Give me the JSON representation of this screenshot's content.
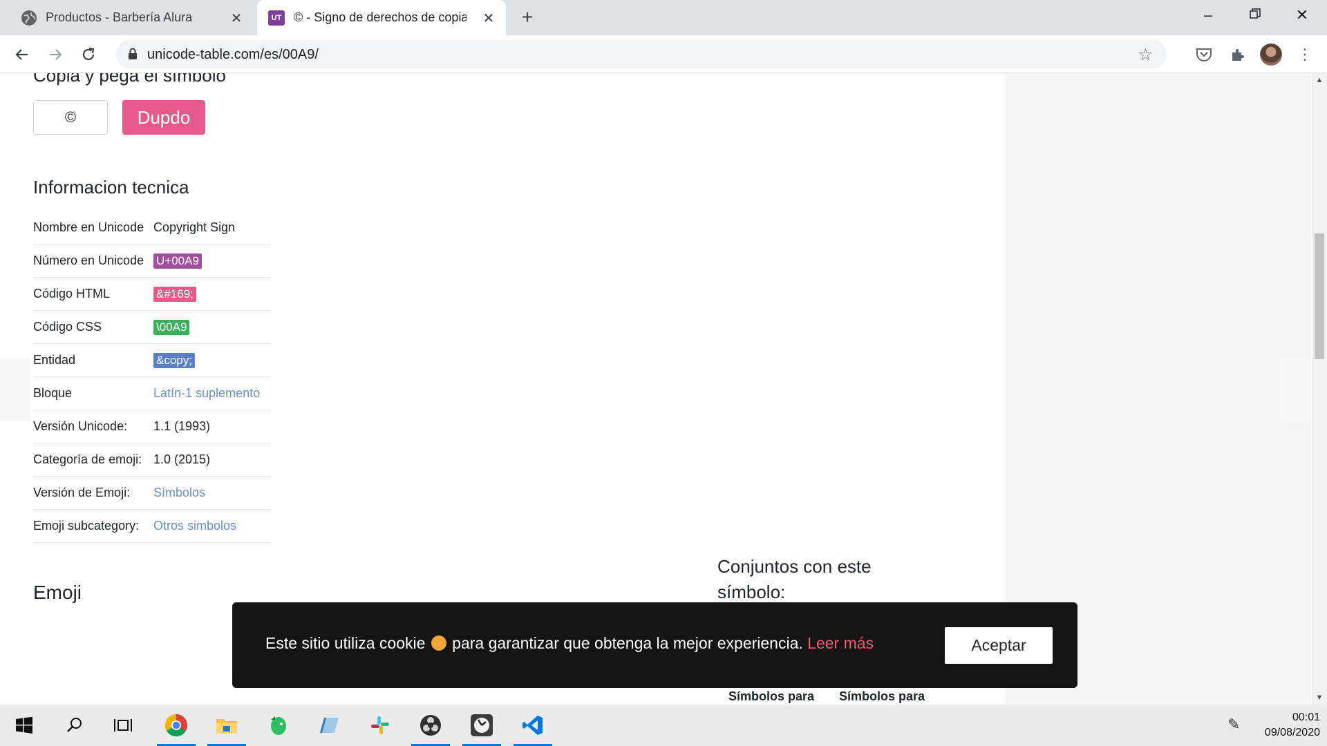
{
  "browser": {
    "tabs": [
      {
        "title": "Productos - Barbería Alura",
        "favicon": "globe-icon"
      },
      {
        "title": "© - Signo de derechos de copia",
        "favicon": "ut-icon"
      }
    ],
    "url": "unicode-table.com/es/00A9/",
    "favicon_ut_text": "UT"
  },
  "page": {
    "copy_heading": "Copia y pega el símbolo",
    "symbol": "©",
    "copy_button": "Dupdo",
    "info_heading": "Informacion tecnica",
    "info_rows": [
      {
        "key": "Nombre en Unicode",
        "value": "Copyright Sign"
      },
      {
        "key": "Número en Unicode",
        "value": "U+00A9"
      },
      {
        "key": "Código HTML",
        "value": "&#169;"
      },
      {
        "key": "Código CSS",
        "value": "\\00A9"
      },
      {
        "key": "Entidad",
        "value": "&copy;"
      },
      {
        "key": "Bloque",
        "value": "Latín-1 suplemento"
      },
      {
        "key": "Versión Unicode:",
        "value": "1.1 (1993)"
      },
      {
        "key": "Categoría de emoji:",
        "value": "1.0 (2015)"
      },
      {
        "key": "Versión de Emoji:",
        "value": "Símbolos"
      },
      {
        "key": "Emoji subcategory:",
        "value": "Otros simbolos"
      }
    ],
    "emoji_heading": "Emoji",
    "sets_heading": "Conjuntos con este símbolo:",
    "sets_links": [
      "Símbolos para",
      "Símbolos para"
    ]
  },
  "cookie_banner": {
    "text_before": "Este sitio utiliza cookie",
    "text_after": "para garantizar que obtenga la mejor experiencia.",
    "link": "Leer más",
    "button": "Aceptar"
  },
  "taskbar": {
    "time": "00:01",
    "date": "09/08/2020",
    "apps": [
      "windows-start-icon",
      "search-icon",
      "task-view-icon",
      "chrome-icon",
      "file-explorer-icon",
      "evernote-icon",
      "notes-app-icon",
      "slack-icon",
      "obs-icon",
      "clock-app-icon",
      "vscode-icon"
    ]
  },
  "colors": {
    "accent_pink": "#e55a8a",
    "badge_purple": "#a24e9f",
    "badge_green": "#3fae5b",
    "badge_blue": "#5a7fc5",
    "link_blue": "#6a8fc7",
    "cookie_link": "#ef5a7a"
  }
}
